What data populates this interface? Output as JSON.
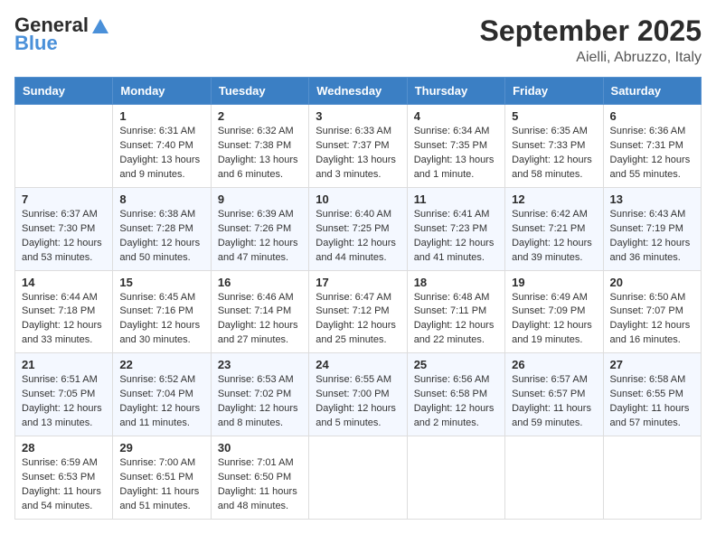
{
  "header": {
    "logo_line1": "General",
    "logo_line2": "Blue",
    "month_title": "September 2025",
    "location": "Aielli, Abruzzo, Italy"
  },
  "days_of_week": [
    "Sunday",
    "Monday",
    "Tuesday",
    "Wednesday",
    "Thursday",
    "Friday",
    "Saturday"
  ],
  "weeks": [
    [
      {
        "day": "",
        "info": ""
      },
      {
        "day": "1",
        "info": "Sunrise: 6:31 AM\nSunset: 7:40 PM\nDaylight: 13 hours\nand 9 minutes."
      },
      {
        "day": "2",
        "info": "Sunrise: 6:32 AM\nSunset: 7:38 PM\nDaylight: 13 hours\nand 6 minutes."
      },
      {
        "day": "3",
        "info": "Sunrise: 6:33 AM\nSunset: 7:37 PM\nDaylight: 13 hours\nand 3 minutes."
      },
      {
        "day": "4",
        "info": "Sunrise: 6:34 AM\nSunset: 7:35 PM\nDaylight: 13 hours\nand 1 minute."
      },
      {
        "day": "5",
        "info": "Sunrise: 6:35 AM\nSunset: 7:33 PM\nDaylight: 12 hours\nand 58 minutes."
      },
      {
        "day": "6",
        "info": "Sunrise: 6:36 AM\nSunset: 7:31 PM\nDaylight: 12 hours\nand 55 minutes."
      }
    ],
    [
      {
        "day": "7",
        "info": "Sunrise: 6:37 AM\nSunset: 7:30 PM\nDaylight: 12 hours\nand 53 minutes."
      },
      {
        "day": "8",
        "info": "Sunrise: 6:38 AM\nSunset: 7:28 PM\nDaylight: 12 hours\nand 50 minutes."
      },
      {
        "day": "9",
        "info": "Sunrise: 6:39 AM\nSunset: 7:26 PM\nDaylight: 12 hours\nand 47 minutes."
      },
      {
        "day": "10",
        "info": "Sunrise: 6:40 AM\nSunset: 7:25 PM\nDaylight: 12 hours\nand 44 minutes."
      },
      {
        "day": "11",
        "info": "Sunrise: 6:41 AM\nSunset: 7:23 PM\nDaylight: 12 hours\nand 41 minutes."
      },
      {
        "day": "12",
        "info": "Sunrise: 6:42 AM\nSunset: 7:21 PM\nDaylight: 12 hours\nand 39 minutes."
      },
      {
        "day": "13",
        "info": "Sunrise: 6:43 AM\nSunset: 7:19 PM\nDaylight: 12 hours\nand 36 minutes."
      }
    ],
    [
      {
        "day": "14",
        "info": "Sunrise: 6:44 AM\nSunset: 7:18 PM\nDaylight: 12 hours\nand 33 minutes."
      },
      {
        "day": "15",
        "info": "Sunrise: 6:45 AM\nSunset: 7:16 PM\nDaylight: 12 hours\nand 30 minutes."
      },
      {
        "day": "16",
        "info": "Sunrise: 6:46 AM\nSunset: 7:14 PM\nDaylight: 12 hours\nand 27 minutes."
      },
      {
        "day": "17",
        "info": "Sunrise: 6:47 AM\nSunset: 7:12 PM\nDaylight: 12 hours\nand 25 minutes."
      },
      {
        "day": "18",
        "info": "Sunrise: 6:48 AM\nSunset: 7:11 PM\nDaylight: 12 hours\nand 22 minutes."
      },
      {
        "day": "19",
        "info": "Sunrise: 6:49 AM\nSunset: 7:09 PM\nDaylight: 12 hours\nand 19 minutes."
      },
      {
        "day": "20",
        "info": "Sunrise: 6:50 AM\nSunset: 7:07 PM\nDaylight: 12 hours\nand 16 minutes."
      }
    ],
    [
      {
        "day": "21",
        "info": "Sunrise: 6:51 AM\nSunset: 7:05 PM\nDaylight: 12 hours\nand 13 minutes."
      },
      {
        "day": "22",
        "info": "Sunrise: 6:52 AM\nSunset: 7:04 PM\nDaylight: 12 hours\nand 11 minutes."
      },
      {
        "day": "23",
        "info": "Sunrise: 6:53 AM\nSunset: 7:02 PM\nDaylight: 12 hours\nand 8 minutes."
      },
      {
        "day": "24",
        "info": "Sunrise: 6:55 AM\nSunset: 7:00 PM\nDaylight: 12 hours\nand 5 minutes."
      },
      {
        "day": "25",
        "info": "Sunrise: 6:56 AM\nSunset: 6:58 PM\nDaylight: 12 hours\nand 2 minutes."
      },
      {
        "day": "26",
        "info": "Sunrise: 6:57 AM\nSunset: 6:57 PM\nDaylight: 11 hours\nand 59 minutes."
      },
      {
        "day": "27",
        "info": "Sunrise: 6:58 AM\nSunset: 6:55 PM\nDaylight: 11 hours\nand 57 minutes."
      }
    ],
    [
      {
        "day": "28",
        "info": "Sunrise: 6:59 AM\nSunset: 6:53 PM\nDaylight: 11 hours\nand 54 minutes."
      },
      {
        "day": "29",
        "info": "Sunrise: 7:00 AM\nSunset: 6:51 PM\nDaylight: 11 hours\nand 51 minutes."
      },
      {
        "day": "30",
        "info": "Sunrise: 7:01 AM\nSunset: 6:50 PM\nDaylight: 11 hours\nand 48 minutes."
      },
      {
        "day": "",
        "info": ""
      },
      {
        "day": "",
        "info": ""
      },
      {
        "day": "",
        "info": ""
      },
      {
        "day": "",
        "info": ""
      }
    ]
  ]
}
